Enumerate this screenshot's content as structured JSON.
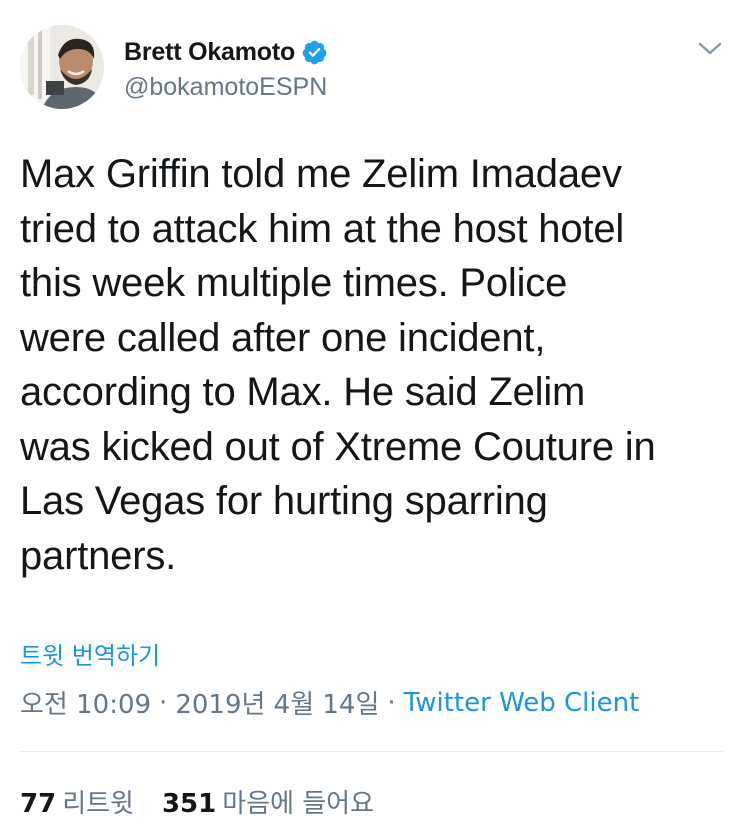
{
  "author": {
    "display_name": "Brett Okamoto",
    "handle": "@bokamotoESPN",
    "verified": true,
    "avatar_icon": "profile-photo"
  },
  "tweet": {
    "text": "Max Griffin told me Zelim Imadaev\ntried to attack him at the host hotel\nthis week multiple times. Police\nwere called after one incident,\naccording to Max. He said Zelim\nwas kicked out of Xtreme Couture in\nLas Vegas for hurting sparring\npartners.",
    "translate_label": "트윗 번역하기"
  },
  "meta": {
    "time": "오전 10:09",
    "separator": "·",
    "date": "2019년 4월 14일",
    "client": "Twitter Web Client"
  },
  "stats": {
    "retweets_count": "77",
    "retweets_label": "리트윗",
    "likes_count": "351",
    "likes_label": "마음에 들어요"
  },
  "colors": {
    "link_blue": "#1b95e0",
    "verified_blue": "#1da1f2",
    "secondary_text": "#657786",
    "primary_text": "#14171a"
  }
}
